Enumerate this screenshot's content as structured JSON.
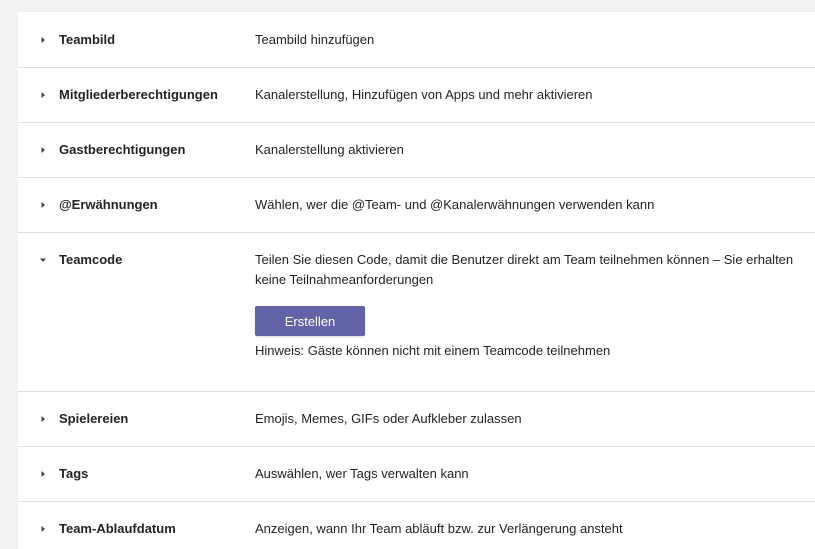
{
  "settings": [
    {
      "title": "Teambild",
      "description": "Teambild hinzufügen",
      "expanded": false
    },
    {
      "title": "Mitgliederberechtigungen",
      "description": "Kanalerstellung, Hinzufügen von Apps und mehr aktivieren",
      "expanded": false
    },
    {
      "title": "Gastberechtigungen",
      "description": "Kanalerstellung aktivieren",
      "expanded": false
    },
    {
      "title": "@Erwähnungen",
      "description": "Wählen, wer die @Team- und @Kanalerwähnungen verwenden kann",
      "expanded": false
    },
    {
      "title": "Teamcode",
      "description": "Teilen Sie diesen Code, damit die Benutzer direkt am Team teilnehmen können – Sie erhalten keine Teilnahmeanforderungen",
      "expanded": true
    },
    {
      "title": "Spielereien",
      "description": "Emojis, Memes, GIFs oder Aufkleber zulassen",
      "expanded": false
    },
    {
      "title": "Tags",
      "description": "Auswählen, wer Tags verwalten kann",
      "expanded": false
    },
    {
      "title": "Team-Ablaufdatum",
      "description": "Anzeigen, wann Ihr Team abläuft bzw. zur Verlängerung ansteht",
      "expanded": false
    }
  ],
  "teamcode": {
    "create_button": "Erstellen",
    "hint": "Hinweis: Gäste können nicht mit einem Teamcode teilnehmen"
  },
  "colors": {
    "accent": "#6264a7",
    "divider": "#e1dfdd",
    "background": "#f3f2f1"
  },
  "icons": {
    "collapsed": "caret-right-icon",
    "expanded": "caret-down-icon"
  }
}
